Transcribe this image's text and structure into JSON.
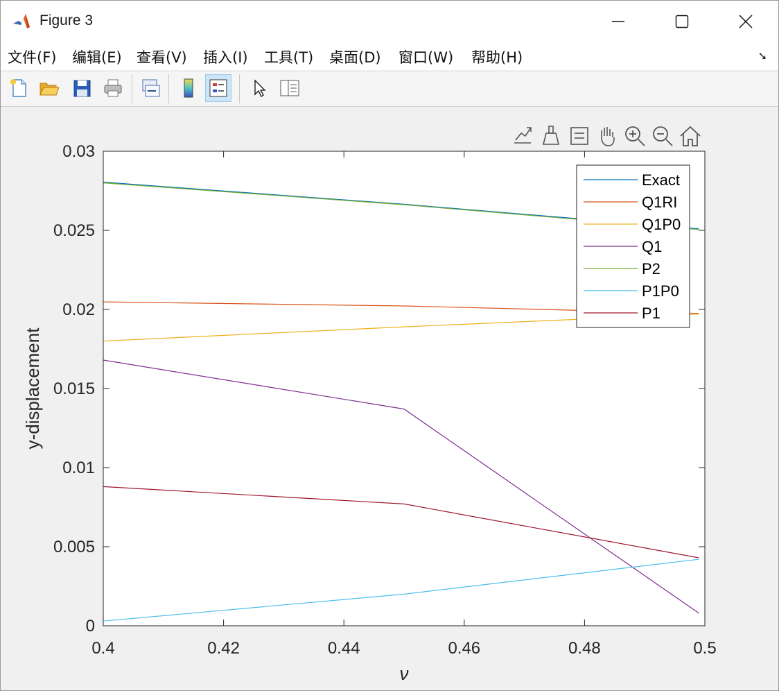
{
  "window": {
    "title": "Figure 3"
  },
  "menu": [
    {
      "label": "文件(F)"
    },
    {
      "label": "编辑(E)"
    },
    {
      "label": "查看(V)"
    },
    {
      "label": "插入(I)"
    },
    {
      "label": "工具(T)"
    },
    {
      "label": "桌面(D)"
    },
    {
      "label": "窗口(W)"
    },
    {
      "label": "帮助(H)"
    }
  ],
  "toolbar": [
    "new-figure-icon",
    "open-file-icon",
    "save-icon",
    "print-icon",
    "link-plot-icon",
    "colorbar-icon",
    "legend-icon",
    "pointer-icon",
    "property-inspector-icon"
  ],
  "axes_toolbar": [
    "export-icon",
    "brush-icon",
    "data-tips-icon",
    "pan-icon",
    "zoom-in-icon",
    "zoom-out-icon",
    "home-icon"
  ],
  "chart_data": {
    "type": "line",
    "title": "",
    "xlabel": "ν",
    "ylabel": "y-displacement",
    "xlim": [
      0.4,
      0.5
    ],
    "ylim": [
      0,
      0.03
    ],
    "xticks": [
      "0.4",
      "0.42",
      "0.44",
      "0.46",
      "0.48",
      "0.5"
    ],
    "xtick_values": [
      0.4,
      0.42,
      0.44,
      0.46,
      0.48,
      0.5
    ],
    "yticks": [
      "0",
      "0.005",
      "0.01",
      "0.015",
      "0.02",
      "0.025",
      "0.03"
    ],
    "ytick_values": [
      0,
      0.005,
      0.01,
      0.015,
      0.02,
      0.025,
      0.03
    ],
    "grid": false,
    "legend_position": "top-right",
    "series": [
      {
        "name": "Exact",
        "color": "#0072BD",
        "x": [
          0.4,
          0.45,
          0.499
        ],
        "y": [
          0.02805,
          0.02665,
          0.0251
        ]
      },
      {
        "name": "Q1RI",
        "color": "#D95319",
        "x": [
          0.4,
          0.45,
          0.499
        ],
        "y": [
          0.02048,
          0.02022,
          0.01975
        ]
      },
      {
        "name": "Q1P0",
        "color": "#EDB120",
        "x": [
          0.4,
          0.45,
          0.499
        ],
        "y": [
          0.018,
          0.0189,
          0.0197
        ]
      },
      {
        "name": "Q1",
        "color": "#7E2F8E",
        "x": [
          0.4,
          0.45,
          0.499
        ],
        "y": [
          0.0168,
          0.0137,
          0.0008
        ]
      },
      {
        "name": "P2",
        "color": "#77AC30",
        "x": [
          0.4,
          0.45,
          0.499
        ],
        "y": [
          0.028,
          0.02662,
          0.02505
        ]
      },
      {
        "name": "P1P0",
        "color": "#4DBEEE",
        "x": [
          0.4,
          0.45,
          0.499
        ],
        "y": [
          0.0003,
          0.002,
          0.0042
        ]
      },
      {
        "name": "P1",
        "color": "#A2142F",
        "x": [
          0.4,
          0.45,
          0.499
        ],
        "y": [
          0.0088,
          0.0077,
          0.0043
        ]
      }
    ]
  }
}
